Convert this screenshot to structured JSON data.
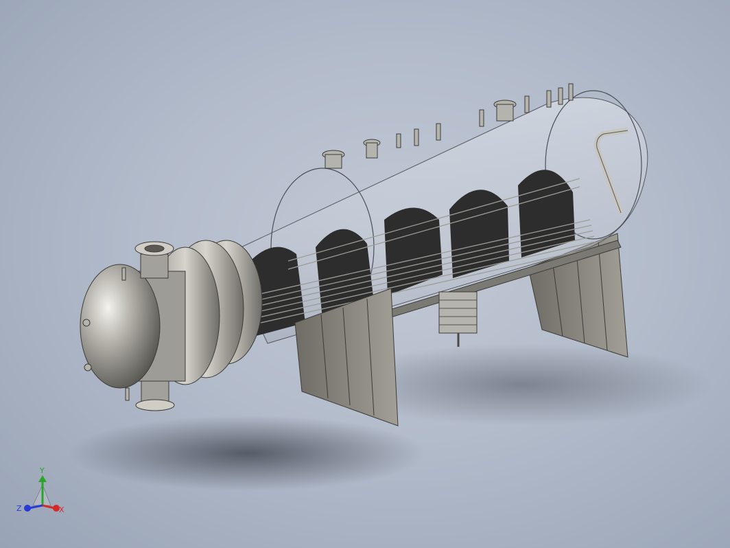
{
  "viewport": {
    "background_top": "#c2c9d6",
    "background_bottom": "#98a3b5"
  },
  "model": {
    "shell_color": "#d9dde3",
    "steel_color": "#8f8e88",
    "baffle_color": "#2c2c2c",
    "support_color": "#8a8780"
  },
  "triad": {
    "x_label": "X",
    "y_label": "Y",
    "z_label": "Z",
    "x_color": "#d42a2a",
    "y_color": "#2aa52a",
    "z_color": "#2a3ad4"
  }
}
